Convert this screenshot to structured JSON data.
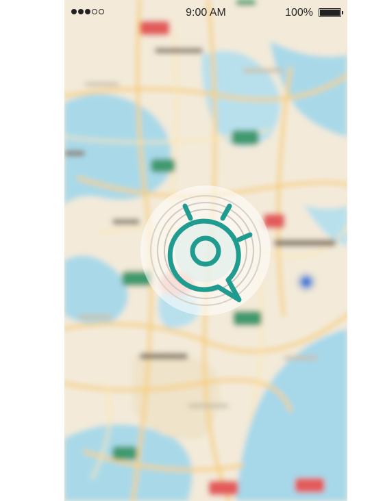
{
  "status_bar": {
    "signal_bars_filled": 3,
    "signal_bars_total": 5,
    "time": "9:00 AM",
    "battery_label": "100%",
    "battery_level": 1.0
  },
  "map": {
    "style": "blurred-street-map",
    "water_color": "#a9d9e8",
    "land_color": "#f3ead9",
    "road_color": "#f6cf7a",
    "pin_colors": [
      "#e35c5c",
      "#3f9a6e"
    ],
    "location_dot_color": "#3a78d6"
  },
  "locator": {
    "icon": "location-search-icon",
    "accent_color": "#1f9c8f"
  }
}
